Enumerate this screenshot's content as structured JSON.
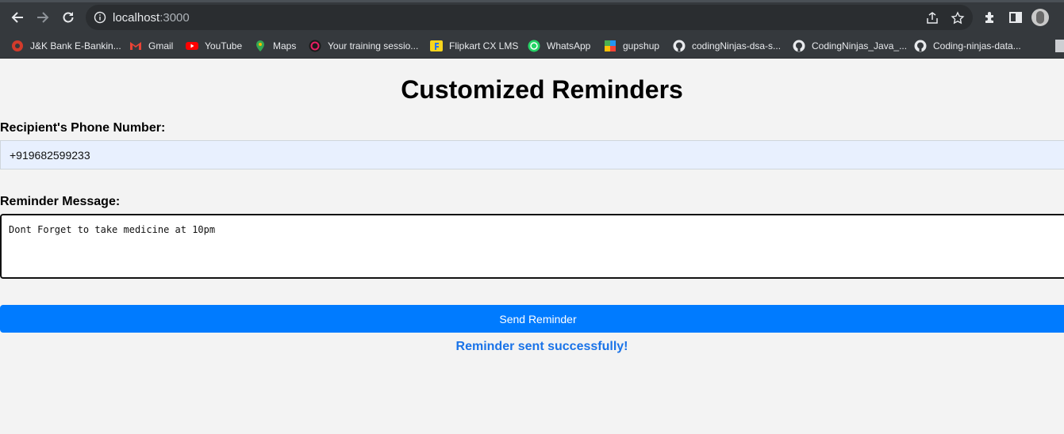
{
  "browser": {
    "url_host": "localhost",
    "url_port": ":3000",
    "bookmarks": [
      {
        "label": "J&K Bank E-Bankin...",
        "icon": "jk-bank-icon",
        "color": "#d23b2b"
      },
      {
        "label": "Gmail",
        "icon": "gmail-icon",
        "color": "#ea4335"
      },
      {
        "label": "YouTube",
        "icon": "youtube-icon",
        "color": "#ff0000"
      },
      {
        "label": "Maps",
        "icon": "maps-icon",
        "color": "#34a853"
      },
      {
        "label": "Your training sessio...",
        "icon": "training-icon",
        "color": "#e91e63"
      },
      {
        "label": "Flipkart CX LMS",
        "icon": "flipkart-icon",
        "color": "#f7d51d"
      },
      {
        "label": "WhatsApp",
        "icon": "whatsapp-icon",
        "color": "#25d366"
      },
      {
        "label": "gupshup",
        "icon": "gupshup-icon",
        "color": "#4caf50"
      },
      {
        "label": "codingNinjas-dsa-s...",
        "icon": "github-icon",
        "color": "#e8eaed"
      },
      {
        "label": "CodingNinjas_Java_...",
        "icon": "github-icon",
        "color": "#e8eaed"
      },
      {
        "label": "Coding-ninjas-data...",
        "icon": "github-icon",
        "color": "#e8eaed"
      }
    ]
  },
  "form": {
    "title": "Customized Reminders",
    "phone_label": "Recipient's Phone Number:",
    "phone_value": "+919682599233",
    "message_label": "Reminder Message:",
    "message_value": "Dont Forget to take medicine at 10pm",
    "send_label": "Send Reminder",
    "status_text": "Reminder sent successfully!"
  },
  "colors": {
    "accent": "#007bff",
    "status": "#1a73e8",
    "chrome": "#35393d"
  }
}
